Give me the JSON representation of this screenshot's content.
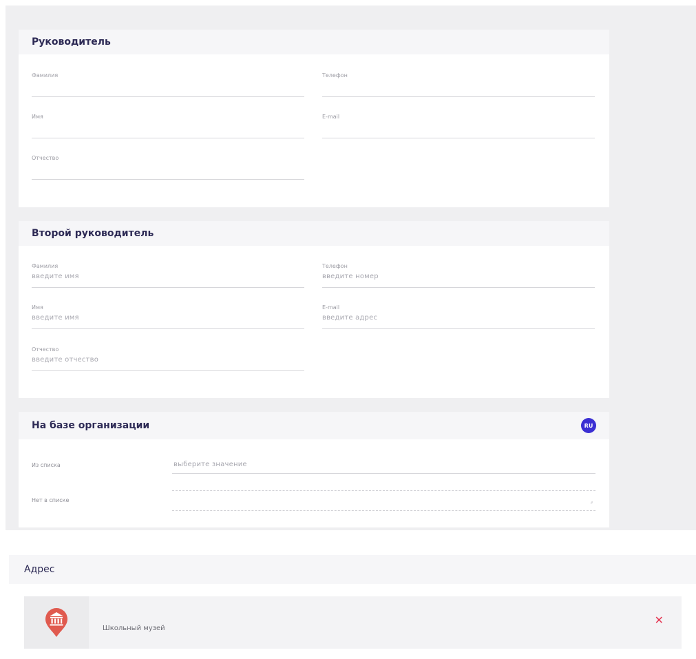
{
  "sections": {
    "head1": {
      "title": "Руководитель",
      "fields": {
        "last_name": {
          "label": "Фамилия",
          "value": ""
        },
        "first_name": {
          "label": "Имя",
          "value": ""
        },
        "patronymic": {
          "label": "Отчество",
          "value": ""
        },
        "phone": {
          "label": "Телефон",
          "value": ""
        },
        "email": {
          "label": "E-mail",
          "value": ""
        }
      }
    },
    "head2": {
      "title": "Второй руководитель",
      "fields": {
        "last_name": {
          "label": "Фамилия",
          "placeholder": "введите имя"
        },
        "first_name": {
          "label": "Имя",
          "placeholder": "введите имя"
        },
        "patronymic": {
          "label": "Отчество",
          "placeholder": "введите отчество"
        },
        "phone": {
          "label": "Телефон",
          "placeholder": "введите номер"
        },
        "email": {
          "label": "E-mail",
          "placeholder": "введите адрес"
        }
      }
    },
    "org": {
      "title": "На базе организации",
      "badge": "RU",
      "from_list_label": "Из списка",
      "from_list_placeholder": "выберите значение",
      "not_in_list_label": "Нет в списке"
    },
    "address": {
      "title": "Адрес",
      "item_name": "Школьный музей"
    }
  },
  "colors": {
    "accent": "#3b2fd3",
    "title": "#2d2a55",
    "delete": "#e53955",
    "marker": "#e05a4f"
  },
  "icons": {
    "marker": "museum-pin-icon",
    "close": "close-icon"
  }
}
